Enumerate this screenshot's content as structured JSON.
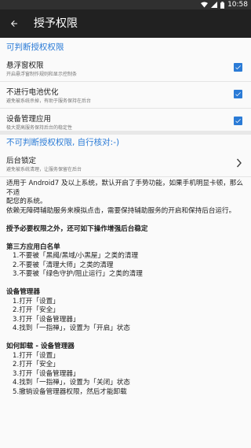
{
  "status_bar": {
    "time": "10:58"
  },
  "app_bar": {
    "title": "授予权限"
  },
  "section_revocable": {
    "header": "可判断授权权限",
    "items": [
      {
        "title": "悬浮窗权限",
        "summary": "开启悬浮窗制作规则和显示控制条",
        "checked": true
      },
      {
        "title": "不进行电池优化",
        "summary": "避免被系统杀掉，有助于服务保持在后台",
        "checked": true
      },
      {
        "title": "设备管理应用",
        "summary": "极大提高服务保持后台的稳定性",
        "checked": true
      }
    ]
  },
  "section_self_check": {
    "header": "不可判断授权权限, 自行核对:-)",
    "items": [
      {
        "title": "后台锁定",
        "summary": "避免被系统清理，让服务保留在后台"
      }
    ]
  },
  "body": {
    "intro": [
      "适用于 Android7 及以上系统，默认开启了手势功能，如果手机明显卡顿，那么不适",
      "配您的系统。",
      "依赖无障碍辅助服务来模拟点击，需要保持辅助服务的开启和保持后台运行。"
    ],
    "bold_heading": "授予必要权限之外，还可如下操作增强后台稳定",
    "groups": [
      {
        "title": "第三方应用白名单",
        "lines": [
          "1.不要被「黑阈/黑域/小黑屋」之类的清理",
          "2.不要被「清理大师」之类的清理",
          "3.不要被「绿色守护/阻止运行」之类的清理"
        ]
      },
      {
        "title": "设备管理器",
        "lines": [
          "1.打开「设置」",
          "2.打开「安全」",
          "3.打开「设备管理器」",
          "4.找到「一指禅」，设置为「开启」状态"
        ]
      },
      {
        "title": "如何卸载 - 设备管理器",
        "lines": [
          "1.打开「设置」",
          "2.打开「安全」",
          "3.打开「设备管理器」",
          "4.找到「一指禅」，设置为「关闭」状态",
          "5.撤销设备管理器权限，然后才能卸载"
        ]
      }
    ]
  }
}
